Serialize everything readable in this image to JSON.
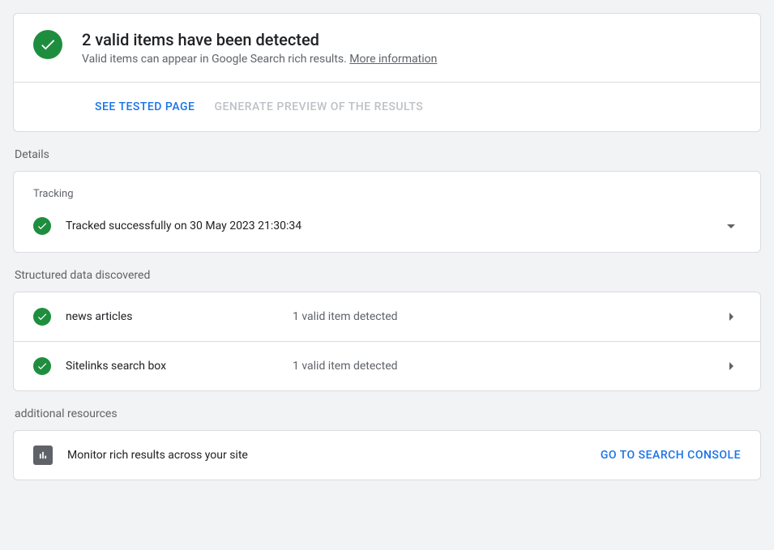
{
  "summary": {
    "title": "2 valid items have been detected",
    "subtitle_pre": "Valid items can appear in Google Search rich results. ",
    "more_info": "More information"
  },
  "actions": {
    "see_tested": "SEE TESTED PAGE",
    "generate_preview": "GENERATE PREVIEW OF THE RESULTS"
  },
  "sections": {
    "details_label": "Details",
    "tracking_label": "Tracking",
    "tracking_status": "Tracked successfully on 30 May 2023 21:30:34",
    "structured_label": "Structured data discovered",
    "additional_label": "additional resources"
  },
  "items": [
    {
      "name": "news articles",
      "status": "1 valid item detected"
    },
    {
      "name": "Sitelinks search box",
      "status": "1 valid item detected"
    }
  ],
  "resource": {
    "text": "Monitor rich results across your site",
    "action": "GO TO SEARCH CONSOLE"
  }
}
